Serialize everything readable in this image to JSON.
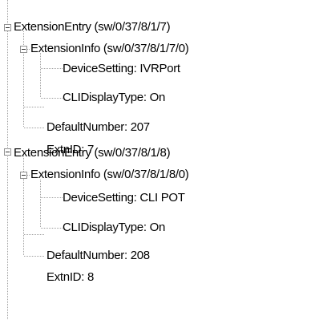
{
  "tree": {
    "nodes": [
      {
        "label": "ExtensionEntry (sw/0/37/8/1/7)",
        "expanded": true
      },
      {
        "label": "ExtensionInfo (sw/0/37/8/1/7/0)",
        "expanded": true
      },
      {
        "label": "DeviceSetting: IVRPort"
      },
      {
        "label": "CLIDisplayType: On"
      },
      {
        "label": "DefaultNumber: 207"
      },
      {
        "label": "ExtnID: 7"
      },
      {
        "label": "ExtensionEntry (sw/0/37/8/1/8)",
        "expanded": true
      },
      {
        "label": "ExtensionInfo (sw/0/37/8/1/8/0)",
        "expanded": true
      },
      {
        "label": "DeviceSetting: CLI POT"
      },
      {
        "label": "CLIDisplayType: On"
      },
      {
        "label": "DefaultNumber: 208"
      },
      {
        "label": "ExtnID: 8"
      }
    ]
  },
  "colors": {
    "guide_line": "#a0a0a0",
    "expander_border": "#919191",
    "text": "#000000"
  }
}
